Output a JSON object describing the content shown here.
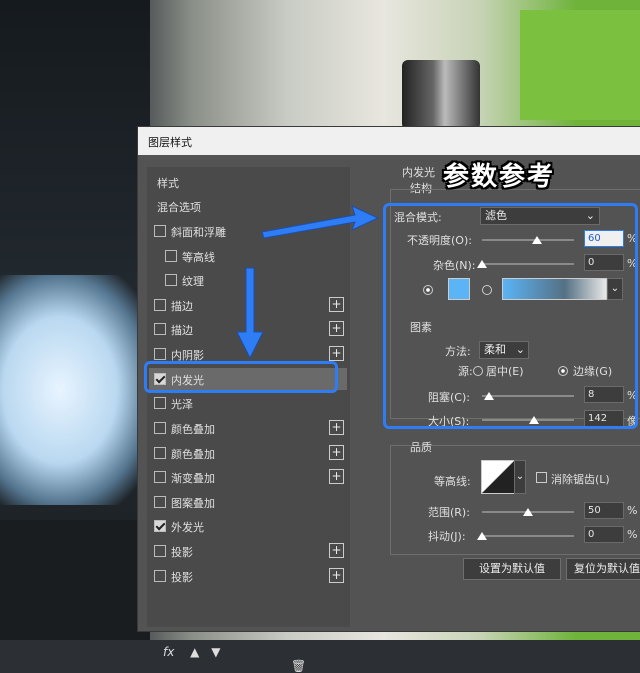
{
  "dialog_title": "图层样式",
  "annotation": "参数参考",
  "left_list": {
    "header_styles": "样式",
    "header_blending": "混合选项",
    "items": [
      {
        "label": "斜面和浮雕",
        "checked": false,
        "plus": false
      },
      {
        "label": "等高线",
        "checked": false,
        "plus": false
      },
      {
        "label": "纹理",
        "checked": false,
        "plus": false
      },
      {
        "label": "描边",
        "checked": false,
        "plus": true
      },
      {
        "label": "描边",
        "checked": false,
        "plus": true
      },
      {
        "label": "内阴影",
        "checked": false,
        "plus": true
      },
      {
        "label": "内发光",
        "checked": true,
        "plus": false
      },
      {
        "label": "光泽",
        "checked": false,
        "plus": false
      },
      {
        "label": "颜色叠加",
        "checked": false,
        "plus": true
      },
      {
        "label": "颜色叠加",
        "checked": false,
        "plus": true
      },
      {
        "label": "渐变叠加",
        "checked": false,
        "plus": true
      },
      {
        "label": "图案叠加",
        "checked": false,
        "plus": false
      },
      {
        "label": "外发光",
        "checked": true,
        "plus": false
      },
      {
        "label": "投影",
        "checked": false,
        "plus": true
      },
      {
        "label": "投影",
        "checked": false,
        "plus": true
      }
    ],
    "fx_label": "fx"
  },
  "inner_glow": {
    "section_title": "内发光",
    "structure_title": "结构",
    "blend_mode_label": "混合模式:",
    "blend_mode_value": "滤色",
    "opacity_label": "不透明度(O):",
    "opacity_value": "60",
    "noise_label": "杂色(N):",
    "noise_value": "0",
    "percent": "%",
    "elements_title": "图素",
    "technique_label": "方法:",
    "technique_value": "柔和",
    "source_label": "源:",
    "source_center": "居中(E)",
    "source_edge": "边缘(G)",
    "choke_label": "阻塞(C):",
    "choke_value": "8",
    "size_label": "大小(S):",
    "size_value": "142",
    "size_unit": "像",
    "quality_title": "品质",
    "contour_label": "等高线:",
    "antialias_label": "消除锯齿(L)",
    "range_label": "范围(R):",
    "range_value": "50",
    "jitter_label": "抖动(J):",
    "jitter_value": "0",
    "btn_make_default": "设置为默认值",
    "btn_reset_default": "复位为默认值"
  },
  "levels": {
    "opacity": 0.6,
    "noise": 0.0,
    "choke": 0.08,
    "size": 0.57,
    "range": 0.5,
    "jitter": 0.0
  },
  "colors": {
    "highlight": "#2f7df5",
    "glow_color": "#5ab4f5"
  }
}
